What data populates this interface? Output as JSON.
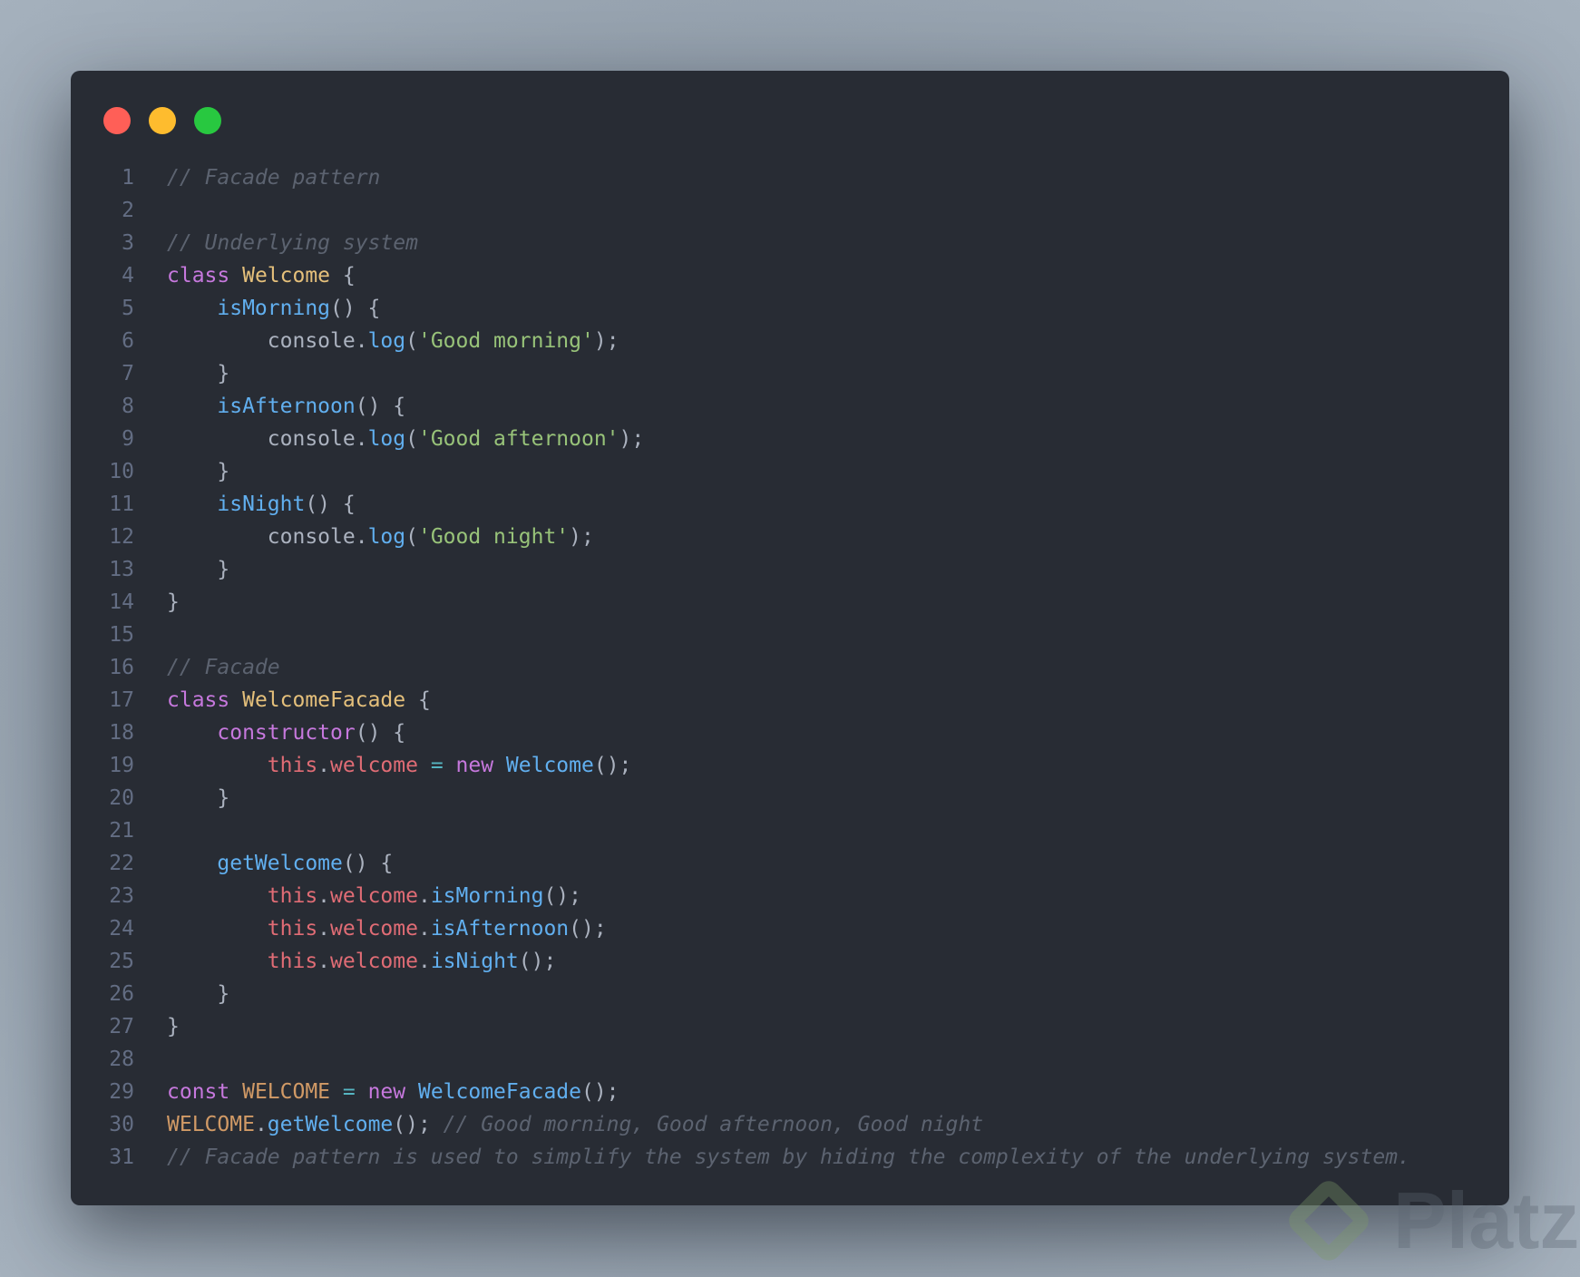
{
  "window": {
    "buttons": {
      "close": "close",
      "minimize": "minimize",
      "maximize": "maximize"
    }
  },
  "colors": {
    "background": "#282c34",
    "comment": "#5c6370",
    "keyword": "#c678dd",
    "class": "#e5c07b",
    "function": "#61afef",
    "string": "#98c379",
    "this": "#e06c75",
    "constant": "#d19a66"
  },
  "code_lines": [
    [
      [
        "comment",
        "// Facade pattern"
      ]
    ],
    [],
    [
      [
        "comment",
        "// Underlying system"
      ]
    ],
    [
      [
        "keyword",
        "class "
      ],
      [
        "class",
        "Welcome"
      ],
      [
        "plain",
        " {"
      ]
    ],
    [
      [
        "plain",
        "    "
      ],
      [
        "func",
        "isMorning"
      ],
      [
        "plain",
        "() {"
      ]
    ],
    [
      [
        "plain",
        "        console."
      ],
      [
        "func",
        "log"
      ],
      [
        "plain",
        "("
      ],
      [
        "string",
        "'Good morning'"
      ],
      [
        "plain",
        ");"
      ]
    ],
    [
      [
        "plain",
        "    }"
      ]
    ],
    [
      [
        "plain",
        "    "
      ],
      [
        "func",
        "isAfternoon"
      ],
      [
        "plain",
        "() {"
      ]
    ],
    [
      [
        "plain",
        "        console."
      ],
      [
        "func",
        "log"
      ],
      [
        "plain",
        "("
      ],
      [
        "string",
        "'Good afternoon'"
      ],
      [
        "plain",
        ");"
      ]
    ],
    [
      [
        "plain",
        "    }"
      ]
    ],
    [
      [
        "plain",
        "    "
      ],
      [
        "func",
        "isNight"
      ],
      [
        "plain",
        "() {"
      ]
    ],
    [
      [
        "plain",
        "        console."
      ],
      [
        "func",
        "log"
      ],
      [
        "plain",
        "("
      ],
      [
        "string",
        "'Good night'"
      ],
      [
        "plain",
        ");"
      ]
    ],
    [
      [
        "plain",
        "    }"
      ]
    ],
    [
      [
        "plain",
        "}"
      ]
    ],
    [],
    [
      [
        "comment",
        "// Facade"
      ]
    ],
    [
      [
        "keyword",
        "class "
      ],
      [
        "class",
        "WelcomeFacade"
      ],
      [
        "plain",
        " {"
      ]
    ],
    [
      [
        "plain",
        "    "
      ],
      [
        "keyword",
        "constructor"
      ],
      [
        "plain",
        "() {"
      ]
    ],
    [
      [
        "plain",
        "        "
      ],
      [
        "this",
        "this"
      ],
      [
        "plain",
        "."
      ],
      [
        "prop",
        "welcome"
      ],
      [
        "op",
        " = "
      ],
      [
        "keyword",
        "new "
      ],
      [
        "func",
        "Welcome"
      ],
      [
        "plain",
        "();"
      ]
    ],
    [
      [
        "plain",
        "    }"
      ]
    ],
    [],
    [
      [
        "plain",
        "    "
      ],
      [
        "func",
        "getWelcome"
      ],
      [
        "plain",
        "() {"
      ]
    ],
    [
      [
        "plain",
        "        "
      ],
      [
        "this",
        "this"
      ],
      [
        "plain",
        "."
      ],
      [
        "prop",
        "welcome"
      ],
      [
        "plain",
        "."
      ],
      [
        "func",
        "isMorning"
      ],
      [
        "plain",
        "();"
      ]
    ],
    [
      [
        "plain",
        "        "
      ],
      [
        "this",
        "this"
      ],
      [
        "plain",
        "."
      ],
      [
        "prop",
        "welcome"
      ],
      [
        "plain",
        "."
      ],
      [
        "func",
        "isAfternoon"
      ],
      [
        "plain",
        "();"
      ]
    ],
    [
      [
        "plain",
        "        "
      ],
      [
        "this",
        "this"
      ],
      [
        "plain",
        "."
      ],
      [
        "prop",
        "welcome"
      ],
      [
        "plain",
        "."
      ],
      [
        "func",
        "isNight"
      ],
      [
        "plain",
        "();"
      ]
    ],
    [
      [
        "plain",
        "    }"
      ]
    ],
    [
      [
        "plain",
        "}"
      ]
    ],
    [],
    [
      [
        "keyword",
        "const "
      ],
      [
        "const",
        "WELCOME"
      ],
      [
        "op",
        " = "
      ],
      [
        "keyword",
        "new "
      ],
      [
        "func",
        "WelcomeFacade"
      ],
      [
        "plain",
        "();"
      ]
    ],
    [
      [
        "const",
        "WELCOME"
      ],
      [
        "plain",
        "."
      ],
      [
        "func",
        "getWelcome"
      ],
      [
        "plain",
        "(); "
      ],
      [
        "comment",
        "// Good morning, Good afternoon, Good night"
      ]
    ],
    [
      [
        "comment",
        "// Facade pattern is used to simplify the system by hiding the complexity of the underlying system."
      ]
    ]
  ],
  "watermark": {
    "text": "Platzi"
  }
}
